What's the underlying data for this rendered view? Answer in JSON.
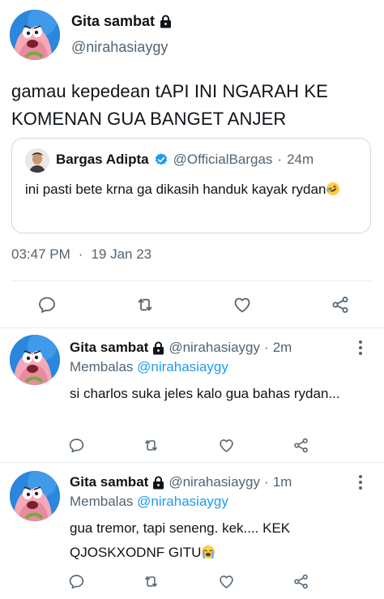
{
  "main_tweet": {
    "name": "Gita sambat",
    "handle": "@nirahasiaygy",
    "text": "gamau kepedean tAPI INI NGARAH KE KOMENAN GUA BANGET ANJER",
    "time": "03:47 PM",
    "dot": "·",
    "date": "19 Jan 23",
    "quote": {
      "name": "Bargas Adipta",
      "handle": "@OfficialBargas",
      "dot": "·",
      "age": "24m",
      "text": "ini pasti bete krna ga dikasih handuk kayak rydan"
    }
  },
  "replies": [
    {
      "name": "Gita sambat",
      "handle": "@nirahasiaygy",
      "dot": "·",
      "age": "2m",
      "replying_label": "Membalas",
      "replying_to": "@nirahasiaygy",
      "text": "si charlos suka jeles kalo gua bahas rydan..."
    },
    {
      "name": "Gita sambat",
      "handle": "@nirahasiaygy",
      "dot": "·",
      "age": "1m",
      "replying_label": "Membalas",
      "replying_to": "@nirahasiaygy",
      "text": "gua tremor, tapi seneng. kek.... KEK QJOSKXODNF GITU"
    }
  ],
  "icons": {
    "reply": "comment-icon",
    "retweet": "retweet-icon",
    "like": "heart-icon",
    "share": "share-icon",
    "lock": "lock-icon",
    "verified": "verified-badge-icon",
    "more": "more-vertical-icon"
  },
  "colors": {
    "accent": "#1d9bf0",
    "secondary_text": "#536471",
    "divider": "#e6ecf0"
  }
}
